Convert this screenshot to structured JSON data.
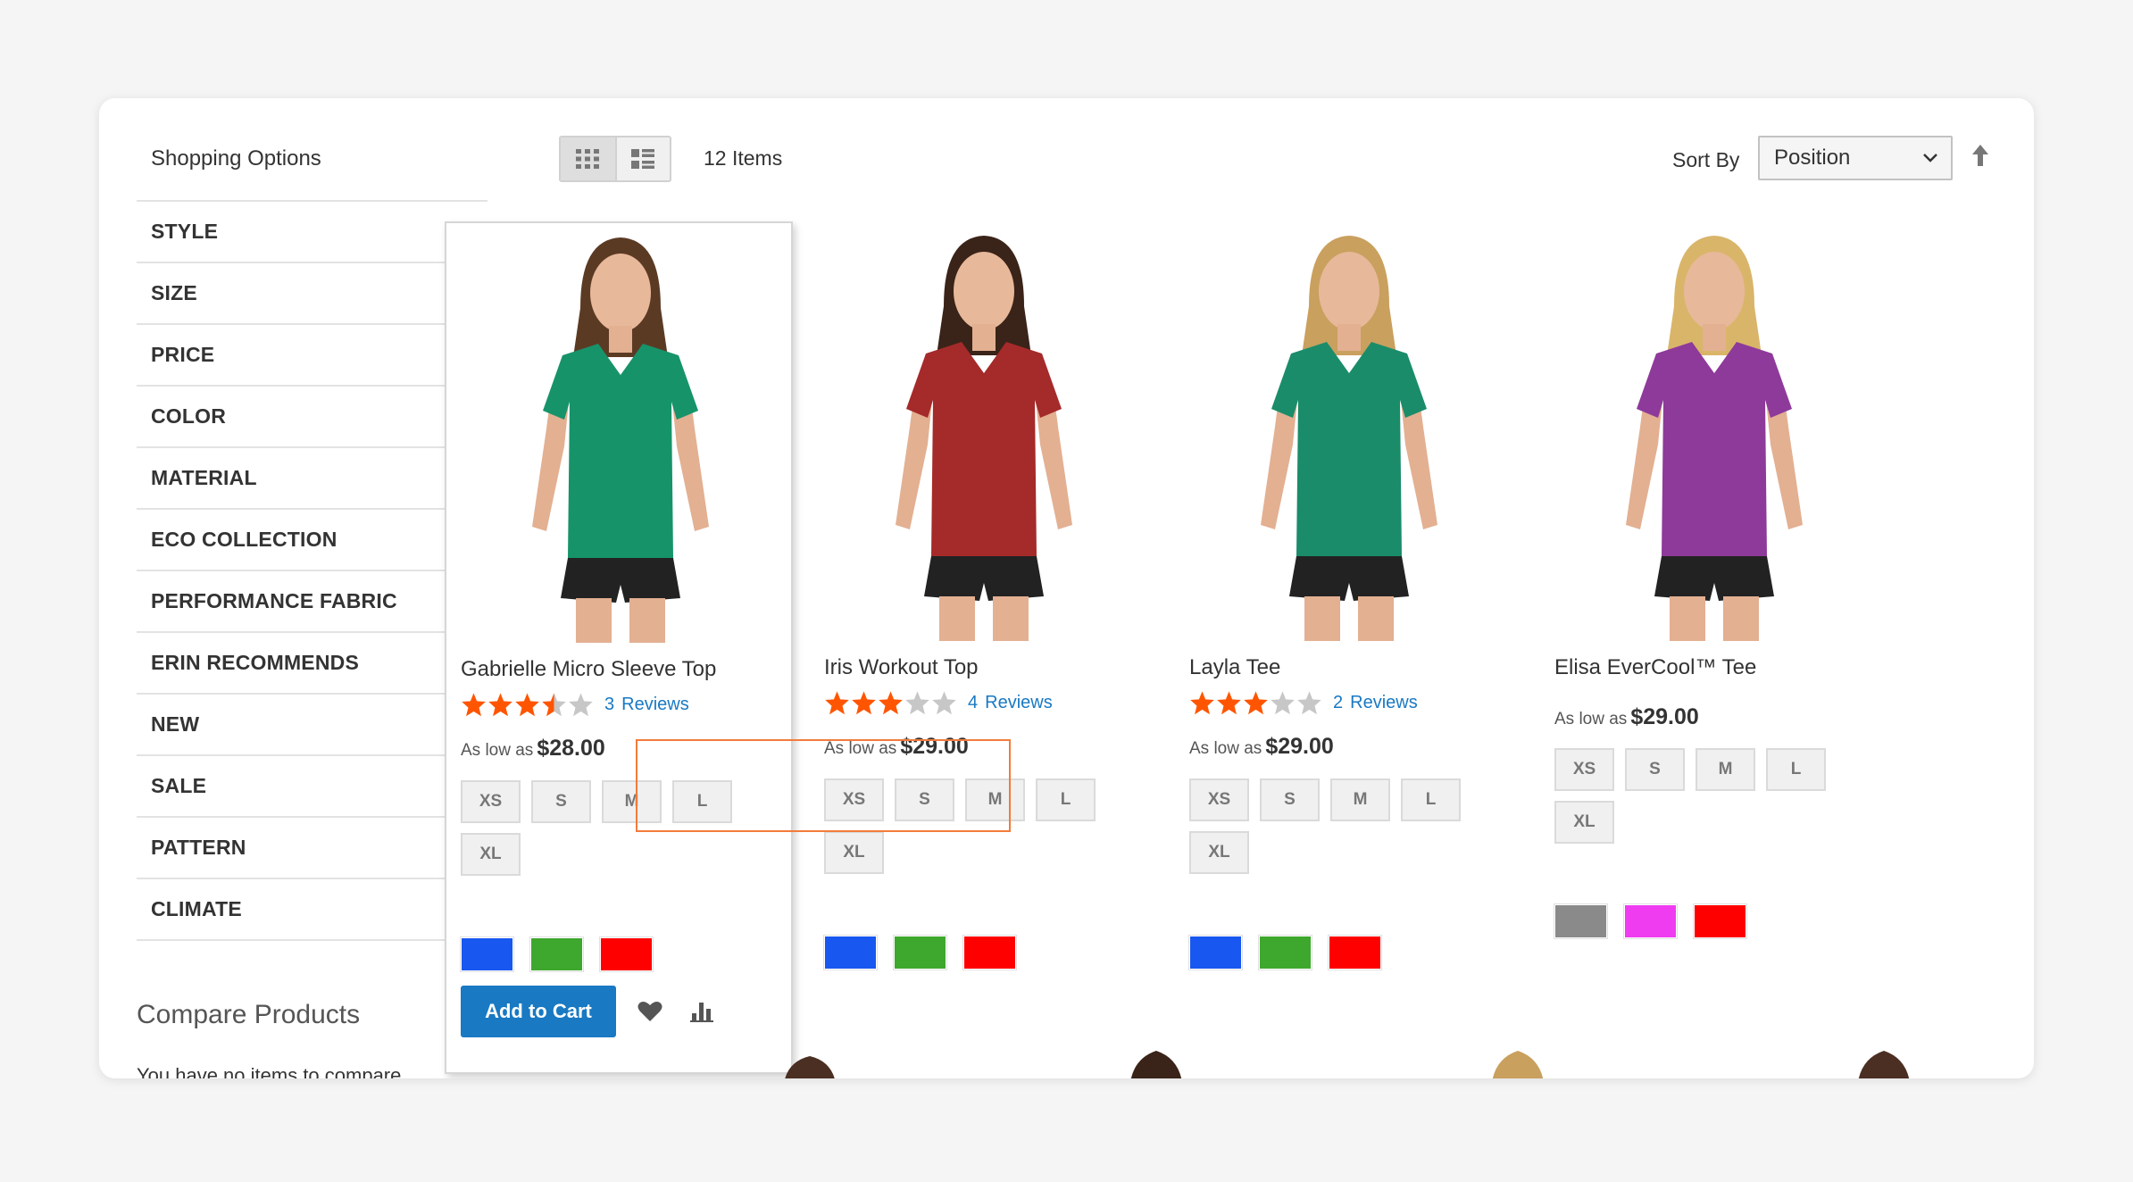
{
  "sidebar": {
    "title": "Shopping Options",
    "filters": [
      "STYLE",
      "SIZE",
      "PRICE",
      "COLOR",
      "MATERIAL",
      "ECO COLLECTION",
      "PERFORMANCE FABRIC",
      "ERIN RECOMMENDS",
      "NEW",
      "SALE",
      "PATTERN",
      "CLIMATE"
    ],
    "compare_title": "Compare Products",
    "compare_text": "You have no items to compare."
  },
  "toolbar": {
    "items_count": "12 Items",
    "sort_label": "Sort By",
    "sort_value": "Position",
    "view_modes": [
      "grid-icon",
      "list-icon"
    ]
  },
  "products": [
    {
      "name": "Gabrielle Micro Sleeve Top",
      "rating": 3.5,
      "review_count": "3",
      "reviews_label": "Reviews",
      "price_label": "As low as",
      "price": "$28.00",
      "sizes": [
        "XS",
        "S",
        "M",
        "L",
        "XL"
      ],
      "colors": [
        "#1857f0",
        "#3ea72d",
        "#ff0000"
      ],
      "shirt_color": "#17936a",
      "hair_color": "#5b3a24",
      "add_to_cart": "Add to Cart",
      "hovered": true
    },
    {
      "name": "Iris Workout Top",
      "rating": 3,
      "review_count": "4",
      "reviews_label": "Reviews",
      "price_label": "As low as",
      "price": "$29.00",
      "sizes": [
        "XS",
        "S",
        "M",
        "L",
        "XL"
      ],
      "colors": [
        "#1857f0",
        "#3ea72d",
        "#ff0000"
      ],
      "shirt_color": "#a52a2a",
      "hair_color": "#3a2318"
    },
    {
      "name": "Layla Tee",
      "rating": 3,
      "review_count": "2",
      "reviews_label": "Reviews",
      "price_label": "As low as",
      "price": "$29.00",
      "sizes": [
        "XS",
        "S",
        "M",
        "L",
        "XL"
      ],
      "colors": [
        "#1857f0",
        "#3ea72d",
        "#ff0000"
      ],
      "shirt_color": "#1a8c6a",
      "hair_color": "#c9a05e"
    },
    {
      "name": "Elisa EverCool™ Tee",
      "rating": 0,
      "review_count": "",
      "reviews_label": "",
      "price_label": "As low as",
      "price": "$29.00",
      "sizes": [
        "XS",
        "S",
        "M",
        "L",
        "XL"
      ],
      "colors": [
        "#8a8a8a",
        "#ef3cf0",
        "#ff0000"
      ],
      "shirt_color": "#8e3a9a",
      "hair_color": "#d9b56a"
    }
  ],
  "colors": {
    "accent": "#1979c3",
    "star": "#ff5501",
    "star_empty": "#c7c7c7",
    "highlight": "#f37b3b"
  }
}
